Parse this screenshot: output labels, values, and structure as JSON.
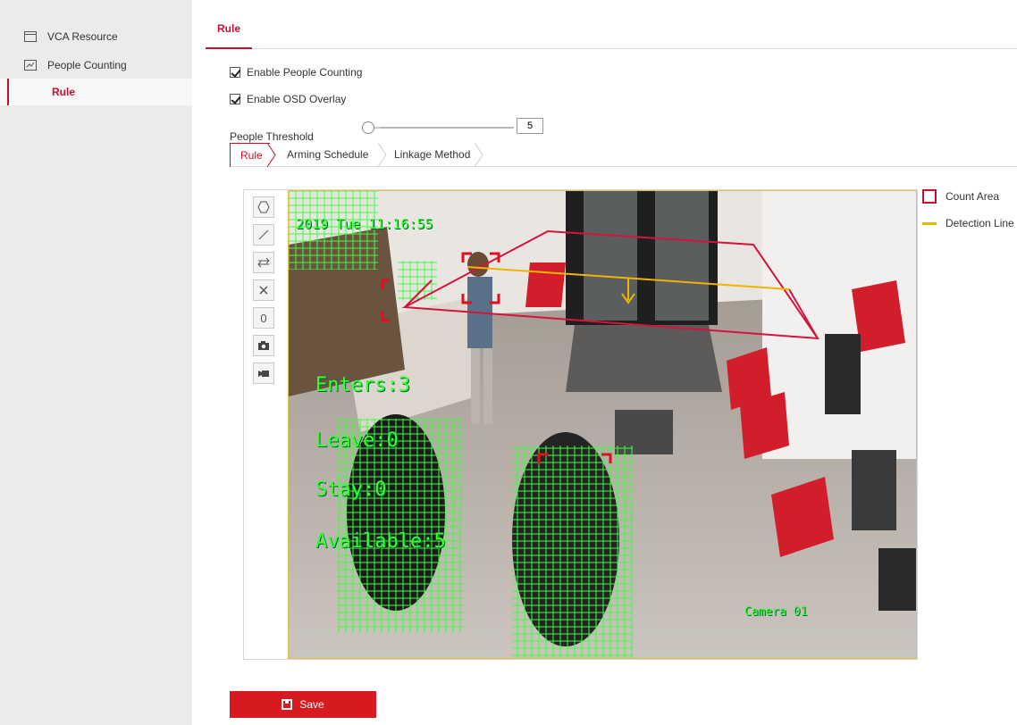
{
  "sidebar": {
    "items": [
      {
        "label": "VCA Resource",
        "icon": "window-icon"
      },
      {
        "label": "People Counting",
        "icon": "chart-icon"
      },
      {
        "label": "Rule",
        "active": true
      }
    ]
  },
  "header": {
    "tab": "Rule"
  },
  "form": {
    "enable_people_counting": {
      "label": "Enable People Counting",
      "checked": true
    },
    "enable_osd": {
      "label": "Enable OSD Overlay",
      "checked": true
    },
    "threshold": {
      "label": "People Threshold",
      "value": "5"
    }
  },
  "sub_tabs": [
    "Rule",
    "Arming Schedule",
    "Linkage Method"
  ],
  "toolbar": {
    "tools": [
      "hexagon-icon",
      "line-icon",
      "swap-arrows-icon",
      "close-icon",
      "zero-icon",
      "camera-icon",
      "video-icon"
    ],
    "zero_label": "0"
  },
  "video": {
    "timestamp": "2019 Tue 11:16:55",
    "enters": "Enters:3",
    "leave": "Leave:0",
    "stay": "Stay:0",
    "available": "Available:5",
    "camera": "Camera 01"
  },
  "legend": {
    "count_area": "Count Area",
    "detection_line": "Detection Line"
  },
  "colors": {
    "accent": "#c8102e",
    "detection_line": "#f0b400",
    "osd": "#33ff33"
  },
  "save_label": "Save"
}
